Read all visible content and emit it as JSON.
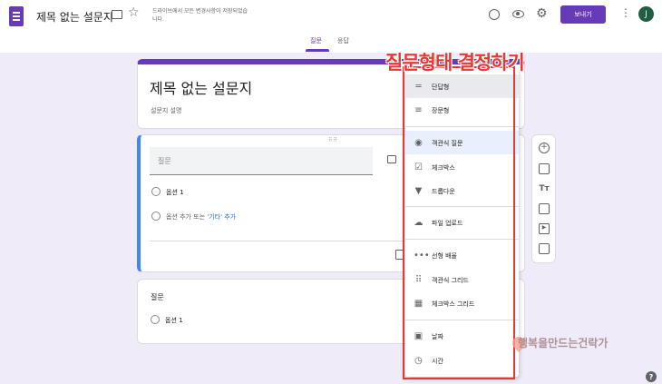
{
  "header": {
    "title": "제목 없는 설문지",
    "notice": "드라이브에서 모든 변경사항이 저장되었습니다.",
    "send_label": "보내기",
    "avatar_letter": "J"
  },
  "tabs": [
    {
      "label": "질문",
      "active": true
    },
    {
      "label": "응답",
      "active": false
    }
  ],
  "title_card": {
    "title": "제목 없는 설문지",
    "description": "설문지 설명"
  },
  "question1": {
    "placeholder": "질문",
    "option1": "옵션 1",
    "add_option": "옵션 추가 또는",
    "add_other": "'기타' 추가"
  },
  "question2": {
    "label": "질문",
    "option1": "옵션 1"
  },
  "menu": {
    "items": [
      {
        "label": "단답형",
        "icon": "short-answer-icon",
        "state": "selected"
      },
      {
        "label": "장문형",
        "icon": "paragraph-icon"
      },
      {
        "label": "객관식 질문",
        "icon": "radio-icon",
        "state": "hover"
      },
      {
        "label": "체크박스",
        "icon": "checkbox-icon"
      },
      {
        "label": "드롭다운",
        "icon": "dropdown-icon"
      },
      {
        "label": "파일 업로드",
        "icon": "upload-icon"
      },
      {
        "label": "선형 배율",
        "icon": "linear-scale-icon"
      },
      {
        "label": "객관식 그리드",
        "icon": "grid-icon"
      },
      {
        "label": "체크박스 그리드",
        "icon": "checkbox-grid-icon"
      },
      {
        "label": "날짜",
        "icon": "date-icon"
      },
      {
        "label": "시간",
        "icon": "time-icon"
      }
    ]
  },
  "annotation": "질문형태 결정하기",
  "watermark": "행복을만드는건락가",
  "colors": {
    "accent": "#673ab7",
    "annotation": "#e53935",
    "focus": "#4285f4",
    "link": "#1a73e8"
  }
}
